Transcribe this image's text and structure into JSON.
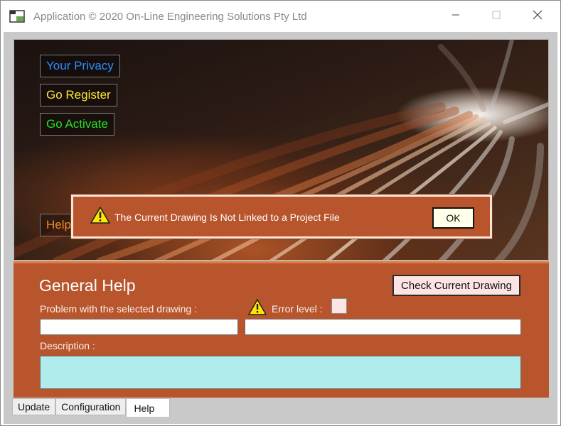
{
  "window": {
    "title": "Application © 2020 On-Line Engineering Solutions Pty Ltd",
    "icons": {
      "app": "application-icon",
      "minimize": "minimize-icon",
      "maximize": "maximize-icon",
      "close": "close-icon"
    }
  },
  "hero": {
    "privacy_label": "Your Privacy",
    "register_label": "Go Register",
    "activate_label": "Go Activate",
    "help_label": "Help",
    "colors": {
      "privacy": "#2f8cff",
      "register": "#ffe33a",
      "activate": "#23e023",
      "help": "#f08a2a"
    }
  },
  "panel": {
    "title": "General Help",
    "check_button_label": "Check Current Drawing",
    "problem_label": "Problem with the selected drawing :",
    "error_level_label": "Error level :",
    "problem_value": "",
    "error_value": "",
    "description_label": "Description :",
    "description_value": "",
    "warning_icon": "warning-icon",
    "accent_color": "#b8552c"
  },
  "tabs": [
    {
      "label": "Update",
      "active": false
    },
    {
      "label": "Configuration",
      "active": false
    },
    {
      "label": "Help",
      "active": true
    }
  ],
  "alert": {
    "message": "The Current Drawing Is Not Linked to a Project File",
    "ok_label": "OK",
    "icon": "warning-icon"
  }
}
